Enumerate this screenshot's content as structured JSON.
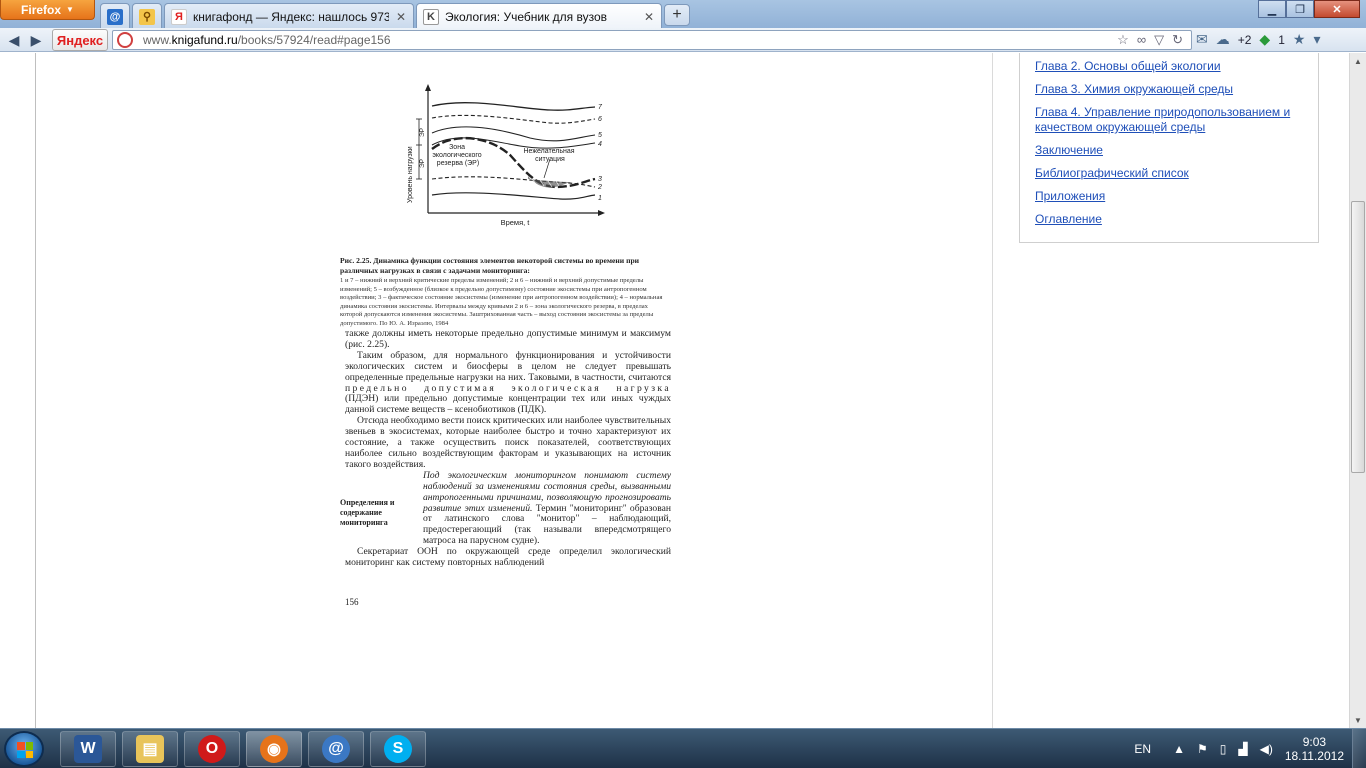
{
  "browser": {
    "menu_button": "Firefox",
    "tabs": [
      {
        "label": ""
      },
      {
        "label": ""
      },
      {
        "label": "книгафонд — Яндекс: нашлось 973 ..."
      },
      {
        "label": "Экология: Учебник для вузов"
      }
    ],
    "url": {
      "prefix": "www.",
      "host": "knigafund.ru",
      "path": "/books/57924/read#page156"
    },
    "search_engine": "Яндекс",
    "toolbar_badges": {
      "weather": "+2",
      "count": "1"
    }
  },
  "book_page": {
    "figure": {
      "ylabel": "Уровень нагрузки",
      "xlabel": "Время, t",
      "er_labels": [
        "ЭР",
        "ЭР"
      ],
      "curve_numbers": [
        "7",
        "6",
        "5",
        "4",
        "3",
        "2",
        "1"
      ],
      "zone_label": "Зона экологического резерва (ЭР)",
      "undesirable_label": "Нежелательная ситуация"
    },
    "caption_title": "Рис. 2.25. Динамика функции состояния элементов некоторой системы во времени при различных нагрузках в связи с задачами мониторинга:",
    "caption_body": "1 и 7 – нижний и верхний критические пределы изменений; 2 и 6 – нижний и верхний допустимые пределы изменений; 5 – возбужденное (близкое к предельно допустимому) состояние экосистемы при антропогенном воздействии; 3 – фактическое состояние экосистемы (изменение при антропогенном воздействии); 4 – нормальная динамика состояния экосистемы. Интервалы между кривыми 2 и 6 – зона экологического резерва, в пределах которой допускаются изменения экосистемы. Заштрихованная часть – выход состояния экосистемы за пределы допустимого. По Ю. А. Израэлю, 1984",
    "para1": "также должны иметь некоторые предельно допустимые минимум и максимум (рис. 2.25).",
    "para2_start": "Таким образом, для нормального функционирования и устойчивости экологических систем и биосферы в целом не следует превышать определенные предельные нагрузки на них. Таковыми, в частности, считаются",
    "para2_spaced": "предельно допустимая экологическая нагрузка",
    "para2_end": "(ПДЭН) или предельно допустимые концентрации тех или иных чуждых данной системе веществ – ксенобиотиков (ПДК).",
    "para3": "Отсюда необходимо вести поиск критических или наиболее чувствительных звеньев в экосистемах, которые наиболее быстро и точно характеризуют их состояние, а также осуществить поиск показателей, соответствующих наиболее сильно воздействующим факторам и указывающих на источник такого воздействия.",
    "margin_note": "Определения и содержание мониторинга",
    "definition_italic": "Под экологическим мониторингом понимают систему наблюдений за изменениями состояния среды, вызванными антропогенными причинами, позволяющую прогнозировать развитие этих изменений.",
    "definition_rest": " Термин \"мониторинг\" образован от латинского слова \"монитор\" – наблюдающий, предостерегающий (так называли впередсмотрящего матроса на парусном судне).",
    "para5": "Секретариат ООН по окружающей среде определил экологический мониторинг как систему повторных наблюдений",
    "page_number": "156"
  },
  "toc": {
    "items": [
      "Глава 2. Основы общей экологии",
      "Глава 3. Химия окружающей среды",
      "Глава 4. Управление природопользованием и качеством окружающей среды",
      "Заключение",
      "Библиографический список",
      "Приложения",
      "Оглавление"
    ]
  },
  "taskbar": {
    "apps": [
      "word-icon",
      "explorer-icon",
      "opera-icon",
      "firefox-icon",
      "thunderbird-icon",
      "skype-icon"
    ],
    "language": "EN",
    "time": "9:03",
    "date": "18.11.2012"
  },
  "colors": {
    "link": "#1f4fb8",
    "taskbar": "#1e3147",
    "firefox_orange": "#e6731a"
  }
}
